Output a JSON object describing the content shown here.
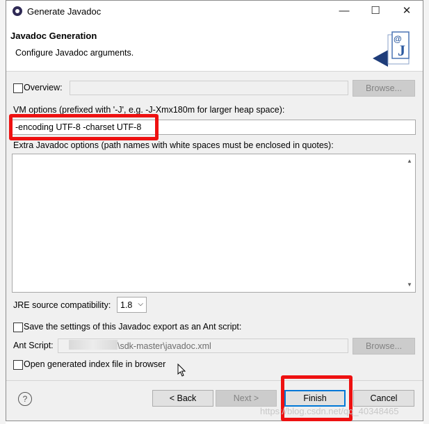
{
  "window": {
    "title": "Generate Javadoc",
    "minimize": "—",
    "maximize": "☐",
    "close": "✕"
  },
  "header": {
    "title": "Javadoc Generation",
    "description": "Configure Javadoc arguments."
  },
  "overview": {
    "label": "Overview:",
    "browse": "Browse..."
  },
  "vm_options": {
    "label": "VM options (prefixed with '-J', e.g. -J-Xmx180m for larger heap space):",
    "value": "-encoding UTF-8 -charset UTF-8"
  },
  "extra_options": {
    "label": "Extra Javadoc options (path names with white spaces must be enclosed in quotes):"
  },
  "jre": {
    "label": "JRE source compatibility:",
    "value": "1.8"
  },
  "ant": {
    "save_label": "Save the settings of this Javadoc export as an Ant script:",
    "script_label": "Ant Script:",
    "script_value": "\\sdk-master\\javadoc.xml",
    "browse": "Browse..."
  },
  "open_index": {
    "label": "Open generated index file in browser"
  },
  "buttons": {
    "back": "< Back",
    "next": "Next >",
    "finish": "Finish",
    "cancel": "Cancel",
    "help": "?"
  },
  "watermark": "https://blog.csdn.net/qq_40348465",
  "colors": {
    "highlight": "#ee1111",
    "default_button_border": "#0078d7"
  }
}
